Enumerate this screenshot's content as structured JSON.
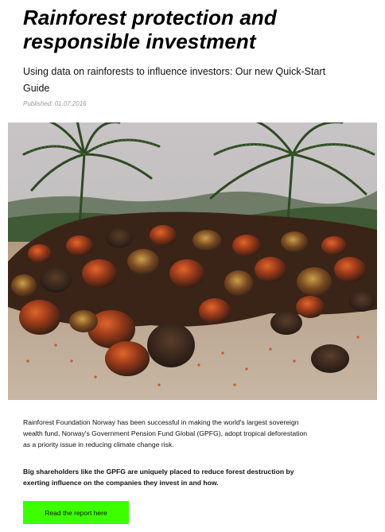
{
  "article": {
    "title": "Rainforest protection and responsible investment",
    "subtitle": "Using data on rainforests to influence investors: Our new Quick-Start Guide",
    "published": "Published: 01.07.2016",
    "paragraph_1": "Rainforest Foundation Norway has been successful in making the world's largest sovereign wealth fund, Norway's Government Pension Fund Global (GPFG), adopt tropical deforestation as a priority issue in reducing climate change risk.",
    "paragraph_2": "Big shareholders like the GPFG are uniquely placed to reduce forest destruction by exerting influence on the companies they invest in and how.",
    "cta_label": "Read the report here"
  },
  "hero_image": {
    "subject": "pile of oil palm fruit bunches under palm trees"
  },
  "colors": {
    "cta_background": "#3dff00",
    "published_text": "#9a9a9a"
  }
}
